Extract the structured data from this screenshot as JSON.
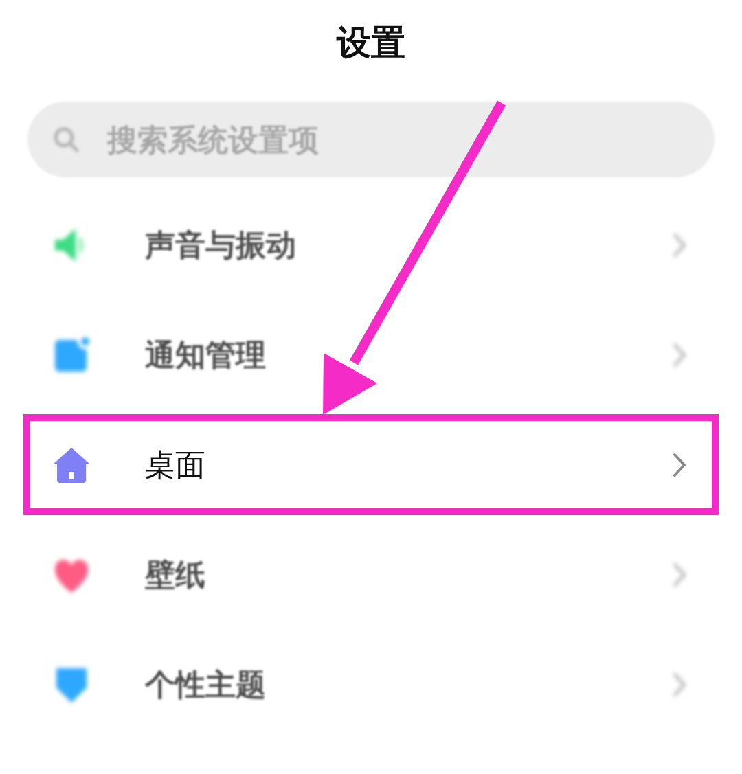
{
  "header": {
    "title": "设置"
  },
  "search": {
    "placeholder": "搜索系统设置项",
    "blurred": true
  },
  "rows": [
    {
      "label": "声音与振动",
      "blurred": true,
      "highlighted": false
    },
    {
      "label": "通知管理",
      "blurred": true,
      "highlighted": false
    },
    {
      "label": "桌面",
      "blurred": false,
      "highlighted": true
    },
    {
      "label": "壁纸",
      "blurred": true,
      "highlighted": false
    },
    {
      "label": "个性主题",
      "blurred": true,
      "highlighted": false
    }
  ]
}
